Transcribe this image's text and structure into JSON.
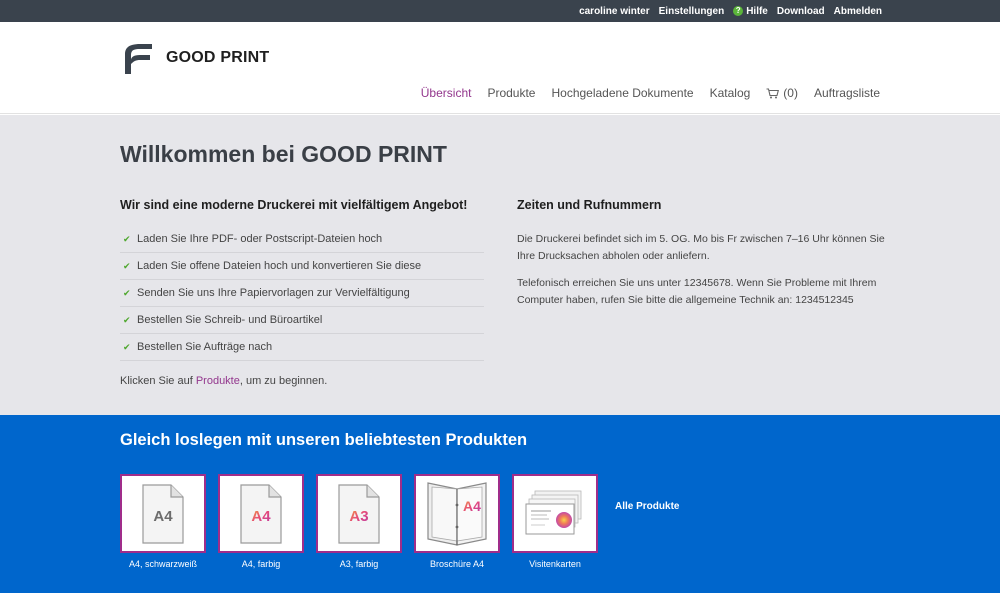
{
  "topbar": {
    "user": "caroline winter",
    "settings": "Einstellungen",
    "help": "Hilfe",
    "help_glyph": "?",
    "download": "Download",
    "logout": "Abmelden"
  },
  "brand": {
    "name": "GOOD PRINT"
  },
  "nav": {
    "overview": "Übersicht",
    "products": "Produkte",
    "uploaded": "Hochgeladene Dokumente",
    "catalog": "Katalog",
    "cart": "(0)",
    "orders": "Auftragsliste"
  },
  "hero": {
    "title": "Willkommen bei GOOD PRINT",
    "left_heading": "Wir sind eine moderne Druckerei mit vielfältigem Angebot!",
    "features": [
      "Laden Sie Ihre PDF- oder Postscript-Dateien hoch",
      "Laden Sie offene Dateien hoch und konvertieren Sie diese",
      "Senden Sie uns Ihre Papiervorlagen zur Vervielfältigung",
      "Bestellen Sie Schreib- und Büroartikel",
      "Bestellen Sie Aufträge nach"
    ],
    "start_prefix": "Klicken Sie auf ",
    "start_link": "Produkte",
    "start_suffix": ", um zu beginnen.",
    "right_heading": "Zeiten und Rufnummern",
    "right_p1": "Die Druckerei befindet sich im 5. OG. Mo bis Fr zwischen 7–16 Uhr können Sie Ihre Drucksachen abholen oder anliefern.",
    "right_p2": "Telefonisch erreichen Sie uns unter 12345678. Wenn Sie Probleme mit Ihrem Computer haben, rufen Sie bitte die allgemeine Technik an: 1234512345"
  },
  "products": {
    "heading": "Gleich loslegen mit unseren beliebtesten Produkten",
    "items": [
      {
        "label": "A4, schwarzweiß",
        "badge": "A4",
        "icon": "document-a4-bw-icon"
      },
      {
        "label": "A4, farbig",
        "badge": "A4",
        "icon": "document-a4-color-icon"
      },
      {
        "label": "A3, farbig",
        "badge": "A3",
        "icon": "document-a3-color-icon"
      },
      {
        "label": "Broschüre A4",
        "badge": "A4",
        "icon": "brochure-icon"
      },
      {
        "label": "Visitenkarten",
        "badge": "",
        "icon": "business-cards-icon"
      }
    ],
    "all": "Alle Produkte"
  },
  "colors": {
    "accent": "#93378d",
    "topbar": "#3a434d",
    "products_bg": "#0066cc",
    "check": "#4ea72d",
    "tile_border": "#a02d8a"
  }
}
